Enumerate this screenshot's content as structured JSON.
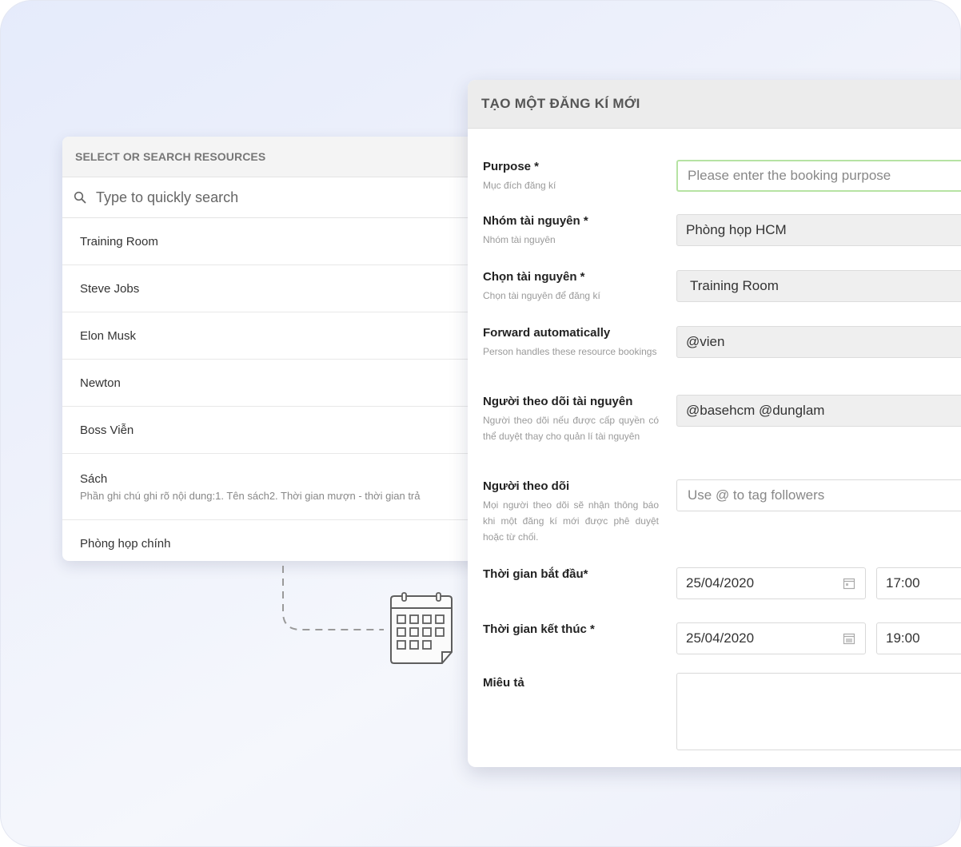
{
  "resources": {
    "header": "SELECT OR SEARCH RESOURCES",
    "search_placeholder": "Type to quickly search",
    "items": [
      {
        "label": "Training Room"
      },
      {
        "label": "Steve Jobs"
      },
      {
        "label": "Elon Musk"
      },
      {
        "label": "Newton"
      },
      {
        "label": "Boss Viễn"
      },
      {
        "label": "Sách",
        "note": "Phần ghi chú ghi rõ nội dung:1. Tên sách2. Thời gian mượn - thời gian trả"
      },
      {
        "label": "Phòng họp chính"
      }
    ]
  },
  "form": {
    "title": "TẠO MỘT ĐĂNG KÍ MỚI",
    "purpose": {
      "label": "Purpose *",
      "sublabel": "Mục đích đăng kí",
      "placeholder": "Please enter the booking purpose"
    },
    "group": {
      "label": "Nhóm tài nguyên *",
      "sublabel": "Nhóm tài nguyên",
      "value": "Phòng họp HCM"
    },
    "resource": {
      "label": "Chọn tài nguyên *",
      "sublabel": "Chọn tài nguyên để đăng kí",
      "value": "Training Room"
    },
    "forward": {
      "label": "Forward automatically",
      "sublabel": "Person handles these resource bookings",
      "value": "@vien"
    },
    "watchers": {
      "label": "Người theo dõi tài nguyên",
      "sublabel": "Người theo dõi nếu được cấp quyền có thể duyệt thay cho quản lí tài nguyên",
      "value": "@basehcm @dunglam"
    },
    "followers": {
      "label": "Người theo dõi",
      "sublabel": "Mọi người theo dõi sẽ nhận thông báo khi một đăng kí mới được phê duyệt hoặc từ chối.",
      "placeholder": "Use @ to tag followers"
    },
    "start": {
      "label": "Thời gian bắt đầu*",
      "date": "25/04/2020",
      "time": "17:00"
    },
    "end": {
      "label": "Thời gian kết thúc *",
      "date": "25/04/2020",
      "time": "19:00"
    },
    "description": {
      "label": "Miêu tả"
    }
  },
  "icons": [
    "search-icon",
    "calendar-icon",
    "calendar-illustration-icon"
  ],
  "colors": {
    "focus_border": "#b6e3a3",
    "background": "#e9eefb"
  }
}
